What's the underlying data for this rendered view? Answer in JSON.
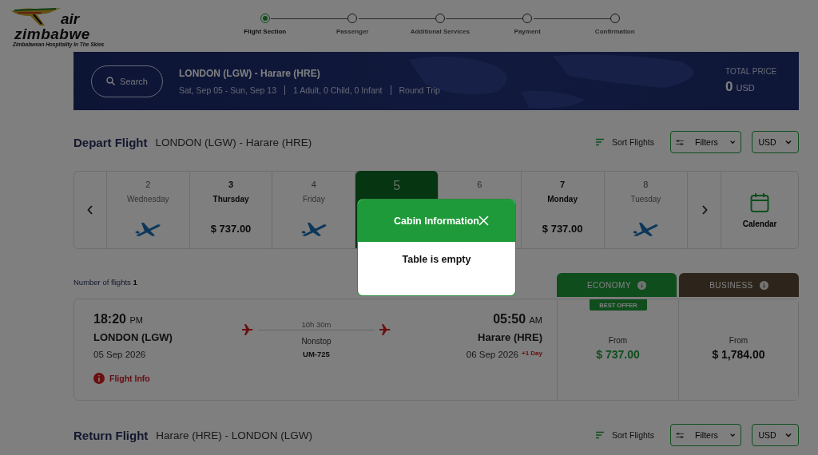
{
  "header": {
    "logo": {
      "name_top": "air",
      "name_bottom": "zimbabwe",
      "tagline": "Zimbabwean Hospitality In The Skies"
    },
    "steps": [
      {
        "label": "Flight Section",
        "selected": true
      },
      {
        "label": "Passenger",
        "selected": false
      },
      {
        "label": "Additional Services",
        "selected": false
      },
      {
        "label": "Payment",
        "selected": false
      },
      {
        "label": "Confirmation",
        "selected": false
      }
    ]
  },
  "search_banner": {
    "search_button": "Search",
    "route": "LONDON (LGW) - Harare (HRE)",
    "dates": "Sat, Sep 05 - Sun, Sep 13",
    "passengers": "1 Adult, 0 Child, 0 Infant",
    "trip_type": "Round Trip",
    "total_label": "TOTAL PRICE",
    "total_amount": "0",
    "total_currency": "USD"
  },
  "depart": {
    "title": "Depart Flight",
    "route": "LONDON (LGW) - Harare (HRE)",
    "sort": "Sort Flights",
    "filters": "Filters",
    "currency": "USD"
  },
  "dates": {
    "days": [
      {
        "day": "2",
        "weekday": "Wednesday",
        "kind": "no-flight",
        "selected": false
      },
      {
        "day": "3",
        "weekday": "Thursday",
        "kind": "price",
        "price": "$ 737.00",
        "selected": false
      },
      {
        "day": "4",
        "weekday": "Friday",
        "kind": "no-flight",
        "selected": false
      },
      {
        "day": "5",
        "selected": true
      },
      {
        "day": "6",
        "selected": false
      },
      {
        "day": "7",
        "weekday": "Monday",
        "kind": "price",
        "price": "$ 737.00",
        "selected": false
      },
      {
        "day": "8",
        "weekday": "Tuesday",
        "kind": "no-flight",
        "selected": false
      }
    ],
    "calendar": "Calendar"
  },
  "flights_count": {
    "label": "Number of flights",
    "value": "1"
  },
  "cabins": [
    {
      "name": "ECONOMY",
      "selected": true
    },
    {
      "name": "BUSINESS",
      "selected": false
    }
  ],
  "flights": [
    {
      "dep_time": "18:20",
      "dep_ampm": "PM",
      "dep_city": "LONDON (LGW)",
      "dep_date": "05 Sep 2026",
      "duration": "10h 30m",
      "stops": "Nonstop",
      "flight_no": "UM-725",
      "arr_time": "05:50",
      "arr_ampm": "AM",
      "arr_city": "Harare (HRE)",
      "arr_date": "06 Sep 2026",
      "day_offset": "+1 Day",
      "info_link": "Flight Info",
      "fares": [
        {
          "badge": "BEST OFFER",
          "label": "From",
          "price": "$ 737.00",
          "highlight": true
        },
        {
          "label": "From",
          "price": "$ 1,784.00",
          "highlight": false
        }
      ]
    }
  ],
  "return": {
    "title": "Return Flight",
    "route": "Harare (HRE) - LONDON (LGW)",
    "sort": "Sort Flights",
    "filters": "Filters",
    "currency": "USD"
  },
  "modal": {
    "title": "Cabin Information",
    "body": "Table is empty"
  }
}
